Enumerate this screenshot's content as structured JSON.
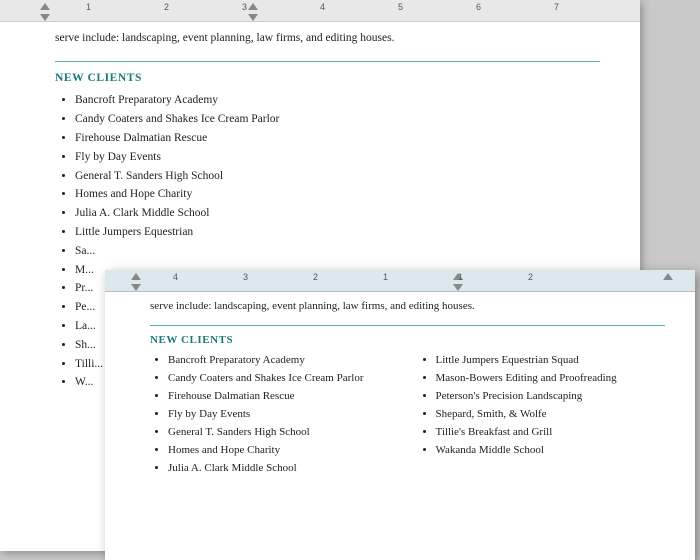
{
  "back_doc": {
    "intro": "serve include: landscaping, event planning, law firms, and editing houses.",
    "section_title": "NEW CLIENTS",
    "clients": [
      "Bancroft Preparatory Academy",
      "Candy Coaters and Shakes Ice Cream Parlor",
      "Firehouse Dalmatian Rescue",
      "Fly by Day Events",
      "General T. Sanders High School",
      "Homes and Hope Charity",
      "Julia A. Clark Middle School",
      "Little Jumpers Equestrian",
      "Sa...",
      "M...",
      "Pr...",
      "Pe...",
      "La...",
      "Sh...",
      "Tilli...",
      "W..."
    ],
    "ruler": {
      "numbers": [
        "1",
        "2",
        "3",
        "4",
        "5",
        "6",
        "7"
      ]
    }
  },
  "front_doc": {
    "intro": "serve include: landscaping, event planning, law firms, and editing houses.",
    "section_title": "NEW CLIENTS",
    "col1": [
      "Bancroft Preparatory Academy",
      "Candy Coaters and Shakes Ice Cream Parlor",
      "Firehouse Dalmatian Rescue",
      "Fly by Day Events",
      "General T. Sanders High School",
      "Homes and Hope Charity",
      "Julia A. Clark Middle School"
    ],
    "col2": [
      "Little Jumpers Equestrian Squad",
      "Mason-Bowers Editing and Proofreading",
      "Peterson's Precision Landscaping",
      "Shepard, Smith, & Wolfe",
      "Tillie's Breakfast and Grill",
      "Wakanda Middle School"
    ],
    "ruler": {
      "numbers": [
        "4",
        "3",
        "2",
        "1",
        "1",
        "2"
      ]
    }
  }
}
